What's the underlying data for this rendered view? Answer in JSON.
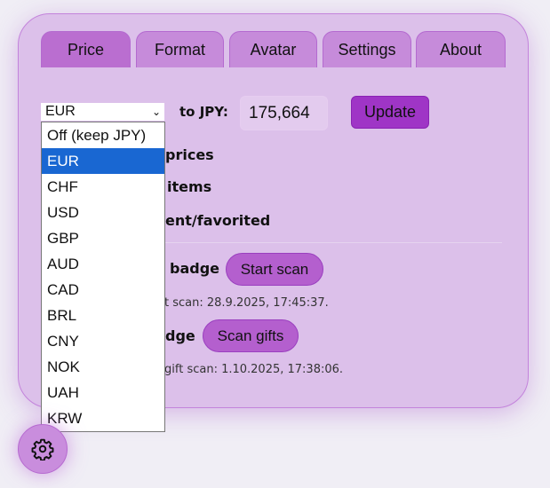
{
  "tabs": [
    "Price",
    "Format",
    "Avatar",
    "Settings",
    "About"
  ],
  "currency_select": {
    "value": "EUR",
    "options": [
      "Off (keep JPY)",
      "EUR",
      "CHF",
      "USD",
      "GBP",
      "AUD",
      "CAD",
      "BRL",
      "CNY",
      "NOK",
      "UAH",
      "KRW"
    ]
  },
  "rate_label": "to JPY:",
  "rate_value": "175,664",
  "update_label": "Update",
  "rows": {
    "prices": "prices",
    "items": "items",
    "favorited": "ent/favorited",
    "badge": "badge",
    "badge2": "dge"
  },
  "start_scan_label": "Start scan",
  "last_scan": "t scan: 28.9.2025, 17:45:37.",
  "scan_gifts_label": "Scan gifts",
  "last_gift_scan": "gift scan: 1.10.2025, 17:38:06.",
  "colors": {
    "accent": "#9f35c6",
    "panel": "#dcc0ea",
    "highlight": "#1967d2"
  }
}
